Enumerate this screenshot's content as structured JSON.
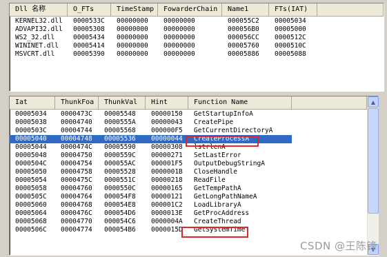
{
  "dll_table": {
    "headers": [
      "Dll 名称",
      "O_FTs",
      "TimeStamp",
      "FowarderChain",
      "Name1",
      "FTs(IAT)"
    ],
    "rows": [
      [
        "KERNEL32.dll",
        "0000533C",
        "00000000",
        "00000000",
        "000055C2",
        "00005034"
      ],
      [
        "ADVAPI32.dll",
        "00005308",
        "00000000",
        "00000000",
        "000056B0",
        "00005000"
      ],
      [
        "WS2_32.dll",
        "00005434",
        "00000000",
        "00000000",
        "000056CC",
        "0000512C"
      ],
      [
        "WININET.dll",
        "00005414",
        "00000000",
        "00000000",
        "00005760",
        "0000510C"
      ],
      [
        "MSVCRT.dll",
        "00005390",
        "00000000",
        "00000000",
        "00005886",
        "00005088"
      ]
    ]
  },
  "func_table": {
    "headers": [
      "Iat",
      "ThunkFoa",
      "ThunkVal",
      "Hint",
      "Function Name"
    ],
    "selected_index": 3,
    "rows": [
      [
        "00005034",
        "0000473C",
        "00005548",
        "00000150",
        "GetStartupInfoA"
      ],
      [
        "00005038",
        "00004740",
        "0000555A",
        "00000043",
        "CreatePipe"
      ],
      [
        "0000503C",
        "00004744",
        "00005568",
        "000000F5",
        "GetCurrentDirectoryA"
      ],
      [
        "00005040",
        "00004748",
        "00005536",
        "00000044",
        "CreateProcessA"
      ],
      [
        "00005044",
        "0000474C",
        "00005590",
        "00000308",
        "lstrlenA"
      ],
      [
        "00005048",
        "00004750",
        "0000559C",
        "00000271",
        "SetLastError"
      ],
      [
        "0000504C",
        "00004754",
        "000055AC",
        "000001F5",
        "OutputDebugStringA"
      ],
      [
        "00005050",
        "00004758",
        "00005528",
        "0000001B",
        "CloseHandle"
      ],
      [
        "00005054",
        "0000475C",
        "0000551C",
        "00000218",
        "ReadFile"
      ],
      [
        "00005058",
        "00004760",
        "0000550C",
        "00000165",
        "GetTempPathA"
      ],
      [
        "0000505C",
        "00004764",
        "000054F8",
        "00000121",
        "GetLongPathNameA"
      ],
      [
        "00005060",
        "00004768",
        "000054E8",
        "000001C2",
        "LoadLibraryA"
      ],
      [
        "00005064",
        "0000476C",
        "000054D6",
        "0000013E",
        "GetProcAddress"
      ],
      [
        "00005068",
        "00004770",
        "000054C6",
        "0000004A",
        "CreateThread"
      ],
      [
        "0000506C",
        "00004774",
        "000054B6",
        "0000015D",
        "GetSystemTime"
      ]
    ]
  },
  "scrollbar": {
    "up_icon": "arrow-up-icon",
    "down_icon": "arrow-down-icon"
  },
  "watermark": "CSDN @王陈锋",
  "colors": {
    "selection": "#316ac5",
    "highlight_box": "#e0242a"
  }
}
